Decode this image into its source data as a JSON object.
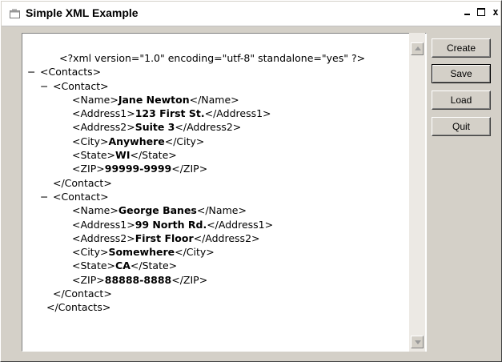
{
  "window": {
    "title": "Simple XML Example",
    "controls": {
      "minimize": "_",
      "maximize": "□",
      "close": "x"
    }
  },
  "xml_lines": [
    {
      "indent": 1,
      "minus": false,
      "parts": [
        {
          "t": "<?xml version=\"1.0\" encoding=\"utf-8\" standalone=\"yes\" ?>",
          "b": false
        }
      ]
    },
    {
      "indent": 0,
      "minus": true,
      "parts": [
        {
          "t": "<Contacts>",
          "b": false
        }
      ]
    },
    {
      "indent": 1,
      "minus": true,
      "parts": [
        {
          "t": "<Contact>",
          "b": false
        }
      ]
    },
    {
      "indent": 2,
      "minus": false,
      "parts": [
        {
          "t": "<Name>",
          "b": false
        },
        {
          "t": "Jane Newton",
          "b": true
        },
        {
          "t": "</Name>",
          "b": false
        }
      ]
    },
    {
      "indent": 2,
      "minus": false,
      "parts": [
        {
          "t": "<Address1>",
          "b": false
        },
        {
          "t": "123 First St.",
          "b": true
        },
        {
          "t": "</Address1>",
          "b": false
        }
      ]
    },
    {
      "indent": 2,
      "minus": false,
      "parts": [
        {
          "t": "<Address2>",
          "b": false
        },
        {
          "t": "Suite 3",
          "b": true
        },
        {
          "t": "</Address2>",
          "b": false
        }
      ]
    },
    {
      "indent": 2,
      "minus": false,
      "parts": [
        {
          "t": "<City>",
          "b": false
        },
        {
          "t": "Anywhere",
          "b": true
        },
        {
          "t": "</City>",
          "b": false
        }
      ]
    },
    {
      "indent": 2,
      "minus": false,
      "parts": [
        {
          "t": "<State>",
          "b": false
        },
        {
          "t": "WI",
          "b": true
        },
        {
          "t": "</State>",
          "b": false
        }
      ]
    },
    {
      "indent": 2,
      "minus": false,
      "parts": [
        {
          "t": "<ZIP>",
          "b": false
        },
        {
          "t": "99999-9999",
          "b": true
        },
        {
          "t": "</ZIP>",
          "b": false
        }
      ]
    },
    {
      "indent": 2,
      "minus": false,
      "parts": [
        {
          "t": "</Contact>",
          "b": false
        }
      ],
      "back": true
    },
    {
      "indent": 1,
      "minus": true,
      "parts": [
        {
          "t": "<Contact>",
          "b": false
        }
      ]
    },
    {
      "indent": 2,
      "minus": false,
      "parts": [
        {
          "t": "<Name>",
          "b": false
        },
        {
          "t": "George Banes",
          "b": true
        },
        {
          "t": "</Name>",
          "b": false
        }
      ]
    },
    {
      "indent": 2,
      "minus": false,
      "parts": [
        {
          "t": "<Address1>",
          "b": false
        },
        {
          "t": "99 North Rd.",
          "b": true
        },
        {
          "t": "</Address1>",
          "b": false
        }
      ]
    },
    {
      "indent": 2,
      "minus": false,
      "parts": [
        {
          "t": "<Address2>",
          "b": false
        },
        {
          "t": "First Floor",
          "b": true
        },
        {
          "t": "</Address2>",
          "b": false
        }
      ]
    },
    {
      "indent": 2,
      "minus": false,
      "parts": [
        {
          "t": "<City>",
          "b": false
        },
        {
          "t": "Somewhere",
          "b": true
        },
        {
          "t": "</City>",
          "b": false
        }
      ]
    },
    {
      "indent": 2,
      "minus": false,
      "parts": [
        {
          "t": "<State>",
          "b": false
        },
        {
          "t": "CA",
          "b": true
        },
        {
          "t": "</State>",
          "b": false
        }
      ]
    },
    {
      "indent": 2,
      "minus": false,
      "parts": [
        {
          "t": "<ZIP>",
          "b": false
        },
        {
          "t": "88888-8888",
          "b": true
        },
        {
          "t": "</ZIP>",
          "b": false
        }
      ]
    },
    {
      "indent": 2,
      "minus": false,
      "parts": [
        {
          "t": "</Contact>",
          "b": false
        }
      ],
      "back": true
    },
    {
      "indent": 1,
      "minus": false,
      "parts": [
        {
          "t": "</Contacts>",
          "b": false
        }
      ]
    }
  ],
  "buttons": {
    "create": "Create",
    "save": "Save",
    "load": "Load",
    "quit": "Quit"
  },
  "icons": {
    "app": "window-icon",
    "scroll_up": "arrow-up-icon",
    "scroll_down": "arrow-down-icon"
  }
}
